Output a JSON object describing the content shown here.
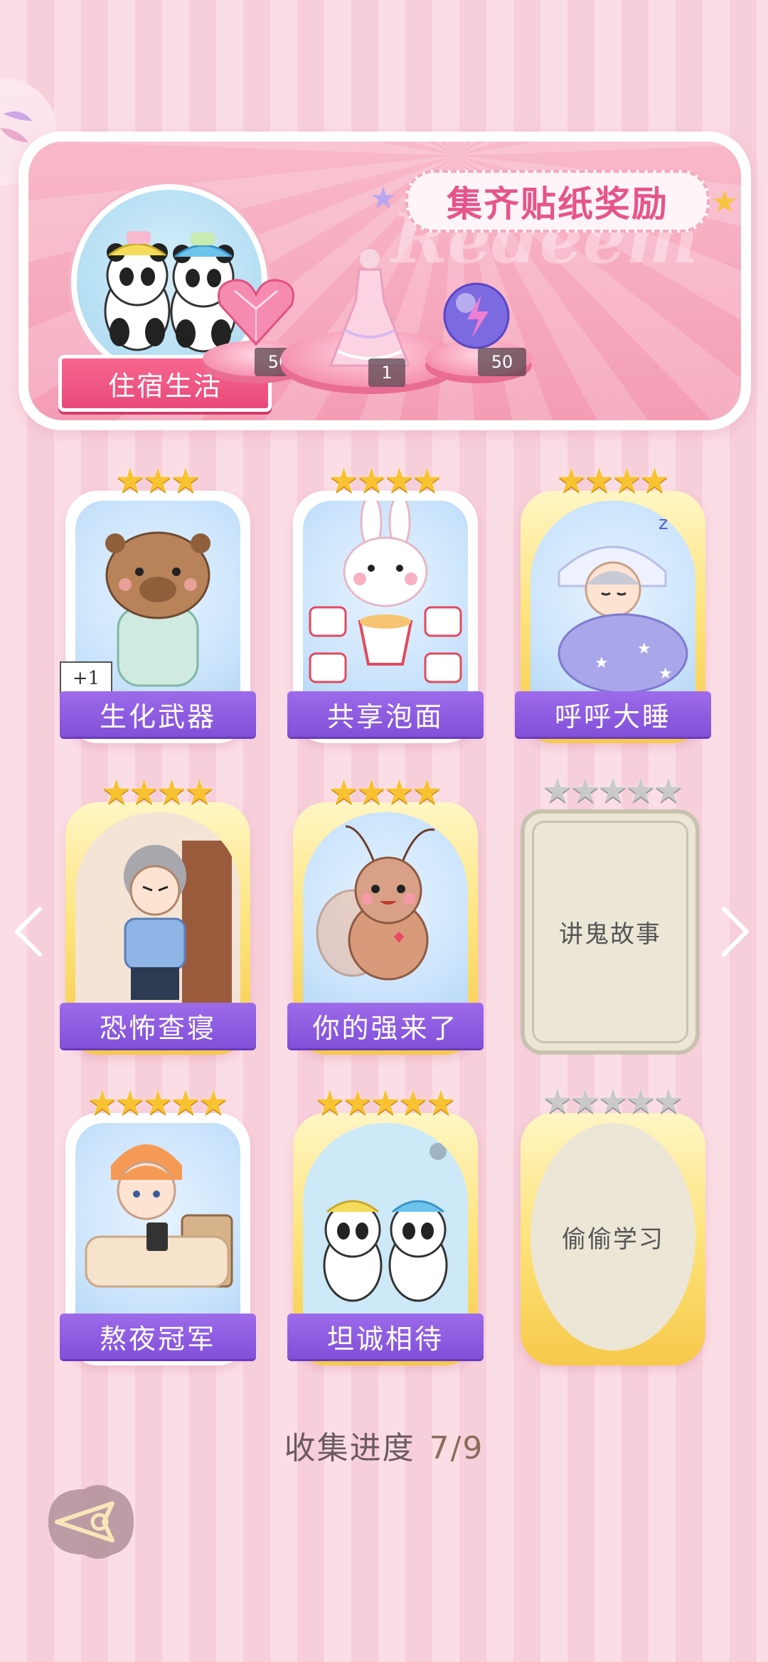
{
  "banner": {
    "title": "集齐贴纸奖励",
    "watermark": "Redeem",
    "set_name": "住宿生活",
    "rewards": [
      {
        "name": "pink-heart-gem",
        "count": "50"
      },
      {
        "name": "pink-dress",
        "count": "1"
      },
      {
        "name": "purple-energy-orb",
        "count": "50"
      }
    ]
  },
  "cards": [
    {
      "label": "生化武器",
      "stars": 3,
      "collected": true,
      "badge": "+1",
      "frame": "white"
    },
    {
      "label": "共享泡面",
      "stars": 4,
      "collected": true,
      "frame": "white"
    },
    {
      "label": "呼呼大睡",
      "stars": 4,
      "collected": true,
      "frame": "gold"
    },
    {
      "label": "恐怖查寝",
      "stars": 4,
      "collected": true,
      "frame": "gold"
    },
    {
      "label": "你的强来了",
      "stars": 4,
      "collected": true,
      "frame": "gold"
    },
    {
      "label": "讲鬼故事",
      "stars": 5,
      "collected": false,
      "frame": "locked-square"
    },
    {
      "label": "熬夜冠军",
      "stars": 5,
      "collected": true,
      "frame": "white"
    },
    {
      "label": "坦诚相待",
      "stars": 5,
      "collected": true,
      "frame": "gold"
    },
    {
      "label": "偷偷学习",
      "stars": 5,
      "collected": false,
      "frame": "locked-oval"
    }
  ],
  "progress": {
    "label": "收集进度",
    "value": "7/9",
    "collected": 7,
    "total": 9
  },
  "nav": {
    "prev_icon": "chevron-left-icon",
    "next_icon": "chevron-right-icon",
    "back_icon": "back-arrow-icon"
  },
  "colors": {
    "accent_pink": "#e6558a",
    "label_purple": "#8050d8",
    "star_gold": "#f8c230",
    "star_grey": "#c9c9c9"
  }
}
